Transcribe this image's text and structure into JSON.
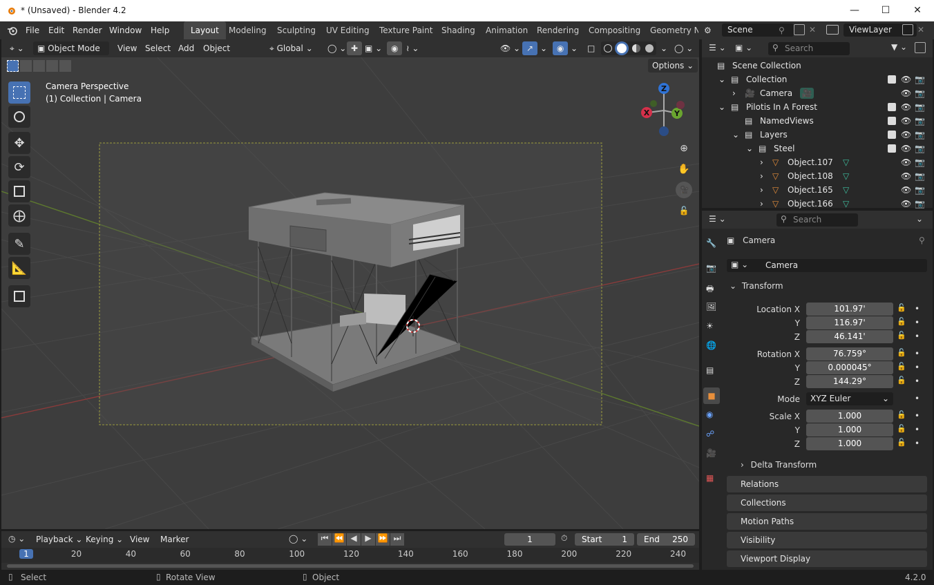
{
  "window": {
    "title": "* (Unsaved) - Blender 4.2"
  },
  "menu": [
    "File",
    "Edit",
    "Render",
    "Window",
    "Help"
  ],
  "workspaces": [
    "Layout",
    "Modeling",
    "Sculpting",
    "UV Editing",
    "Texture Paint",
    "Shading",
    "Animation",
    "Rendering",
    "Compositing",
    "Geometry No"
  ],
  "scene": {
    "name": "Scene",
    "view_layer": "ViewLayer"
  },
  "viewport": {
    "mode": "Object Mode",
    "menus": [
      "View",
      "Select",
      "Add",
      "Object"
    ],
    "orientation": "Global",
    "options": "Options",
    "overlay_title": "Camera Perspective",
    "overlay_sub": "(1) Collection | Camera",
    "gizmo": {
      "z": "Z",
      "x": "X",
      "y": "Y"
    }
  },
  "outliner": {
    "search_placeholder": "Search",
    "rows": [
      {
        "label": "Scene Collection",
        "indent": 0
      },
      {
        "label": "Collection",
        "indent": 1
      },
      {
        "label": "Camera",
        "indent": 2
      },
      {
        "label": "Pilotis In A Forest",
        "indent": 1
      },
      {
        "label": "NamedViews",
        "indent": 2
      },
      {
        "label": "Layers",
        "indent": 2
      },
      {
        "label": "Steel",
        "indent": 3
      },
      {
        "label": "Object.107",
        "indent": 4
      },
      {
        "label": "Object.108",
        "indent": 4
      },
      {
        "label": "Object.165",
        "indent": 4
      },
      {
        "label": "Object.166",
        "indent": 4
      }
    ]
  },
  "properties": {
    "search_placeholder": "Search",
    "object_name": "Camera",
    "data_name": "Camera",
    "transform_label": "Transform",
    "location": {
      "label": "Location X",
      "x": "101.97'",
      "y": "116.97'",
      "z": "46.141'"
    },
    "rotation": {
      "label": "Rotation X",
      "x": "76.759°",
      "y": "0.000045°",
      "z": "144.29°"
    },
    "mode_label": "Mode",
    "mode_value": "XYZ Euler",
    "scale": {
      "label": "Scale X",
      "x": "1.000",
      "y": "1.000",
      "z": "1.000"
    },
    "axis": {
      "y": "Y",
      "z": "Z"
    },
    "delta": "Delta Transform",
    "panels": [
      "Relations",
      "Collections",
      "Motion Paths",
      "Visibility",
      "Viewport Display"
    ]
  },
  "timeline": {
    "menus": [
      "Playback",
      "Keying",
      "View",
      "Marker"
    ],
    "current_frame": "1",
    "start_label": "Start",
    "start": "1",
    "end_label": "End",
    "end": "250",
    "ticks": [
      "1",
      "20",
      "40",
      "60",
      "80",
      "100",
      "120",
      "140",
      "160",
      "180",
      "200",
      "220",
      "240"
    ]
  },
  "status": {
    "left": "Select",
    "middle": "Rotate View",
    "right": "Object",
    "version": "4.2.0"
  },
  "colors": {
    "accent": "#4772b3",
    "camera_green": "#3fbf9f",
    "object_orange": "#e88f3b"
  }
}
